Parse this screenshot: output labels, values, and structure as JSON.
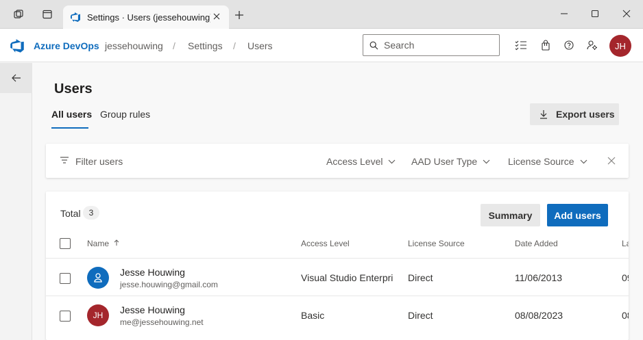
{
  "browser": {
    "tab_title": "Settings · Users (jessehouwing) -"
  },
  "header": {
    "brand": "Azure DevOps",
    "breadcrumbs": [
      "jessehouwing",
      "Settings",
      "Users"
    ],
    "separator": "/",
    "search_placeholder": "Search",
    "avatar_initials": "JH",
    "avatar_color": "#a4262c"
  },
  "page": {
    "title": "Users",
    "tabs": [
      {
        "label": "All users",
        "active": true
      },
      {
        "label": "Group rules",
        "active": false
      }
    ],
    "export_label": "Export users"
  },
  "filter": {
    "placeholder": "Filter users",
    "dropdowns": [
      "Access Level",
      "AAD User Type",
      "License Source"
    ]
  },
  "table": {
    "total_label": "Total",
    "total_count": "3",
    "summary_label": "Summary",
    "add_label": "Add users",
    "columns": [
      "Name",
      "Access Level",
      "License Source",
      "Date Added",
      "La"
    ],
    "rows": [
      {
        "name": "Jesse Houwing",
        "email": "jesse.houwing@gmail.com",
        "access_level": "Visual Studio Enterpri",
        "license_source": "Direct",
        "date_added": "11/06/2013",
        "last": "09",
        "avatar_type": "generic-person-icon",
        "avatar_color": "#0f6cbd"
      },
      {
        "name": "Jesse Houwing",
        "email": "me@jessehouwing.net",
        "access_level": "Basic",
        "license_source": "Direct",
        "date_added": "08/08/2023",
        "last": "08",
        "avatar_initials": "JH",
        "avatar_color": "#a4262c"
      }
    ]
  }
}
